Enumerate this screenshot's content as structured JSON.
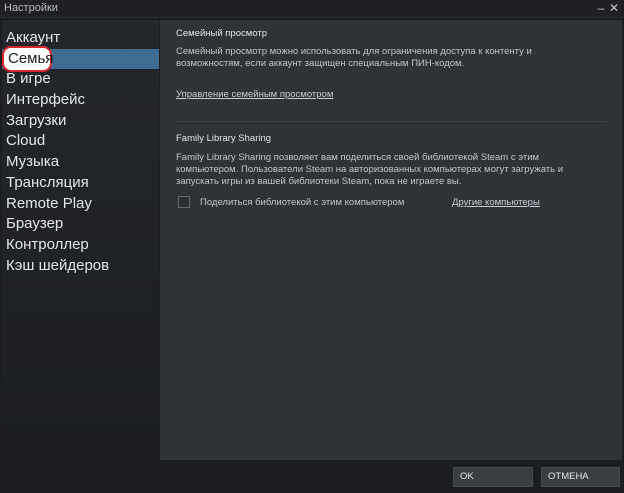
{
  "window": {
    "title": "Настройки",
    "minimize_glyph": "–",
    "close_glyph": "✕"
  },
  "sidebar": {
    "items": [
      {
        "label": "Аккаунт"
      },
      {
        "label": "Семья",
        "active": true
      },
      {
        "label": "В игре"
      },
      {
        "label": "Интерфейс"
      },
      {
        "label": "Загрузки"
      },
      {
        "label": "Cloud"
      },
      {
        "label": "Музыка"
      },
      {
        "label": "Трансляция"
      },
      {
        "label": "Remote Play"
      },
      {
        "label": "Браузер"
      },
      {
        "label": "Контроллер"
      },
      {
        "label": "Кэш шейдеров"
      }
    ]
  },
  "family_view": {
    "title": "Семейный просмотр",
    "description_line1": "Семейный просмотр можно использовать для ограничения доступа к контенту и",
    "description_line2": "возможностям, если аккаунт защищен специальным ПИН-кодом.",
    "manage_link": "Управление семейным просмотром"
  },
  "family_sharing": {
    "title": "Family Library Sharing",
    "description_line1": "Family Library Sharing позволяет вам поделиться своей библиотекой Steam с этим",
    "description_line2": "компьютером. Пользователи Steam на авторизованных компьютерах могут загружать и",
    "description_line3": "запускать игры из вашей библиотеки Steam, пока не играете вы.",
    "checkbox_label": "Поделиться библиотекой с этим компьютером",
    "checkbox_checked": false,
    "other_computers_link": "Другие компьютеры"
  },
  "footer": {
    "ok_label": "OK",
    "cancel_label": "ОТМЕНА"
  },
  "colors": {
    "active_item": "#3d6b91",
    "highlight_ring": "#d8262e"
  }
}
